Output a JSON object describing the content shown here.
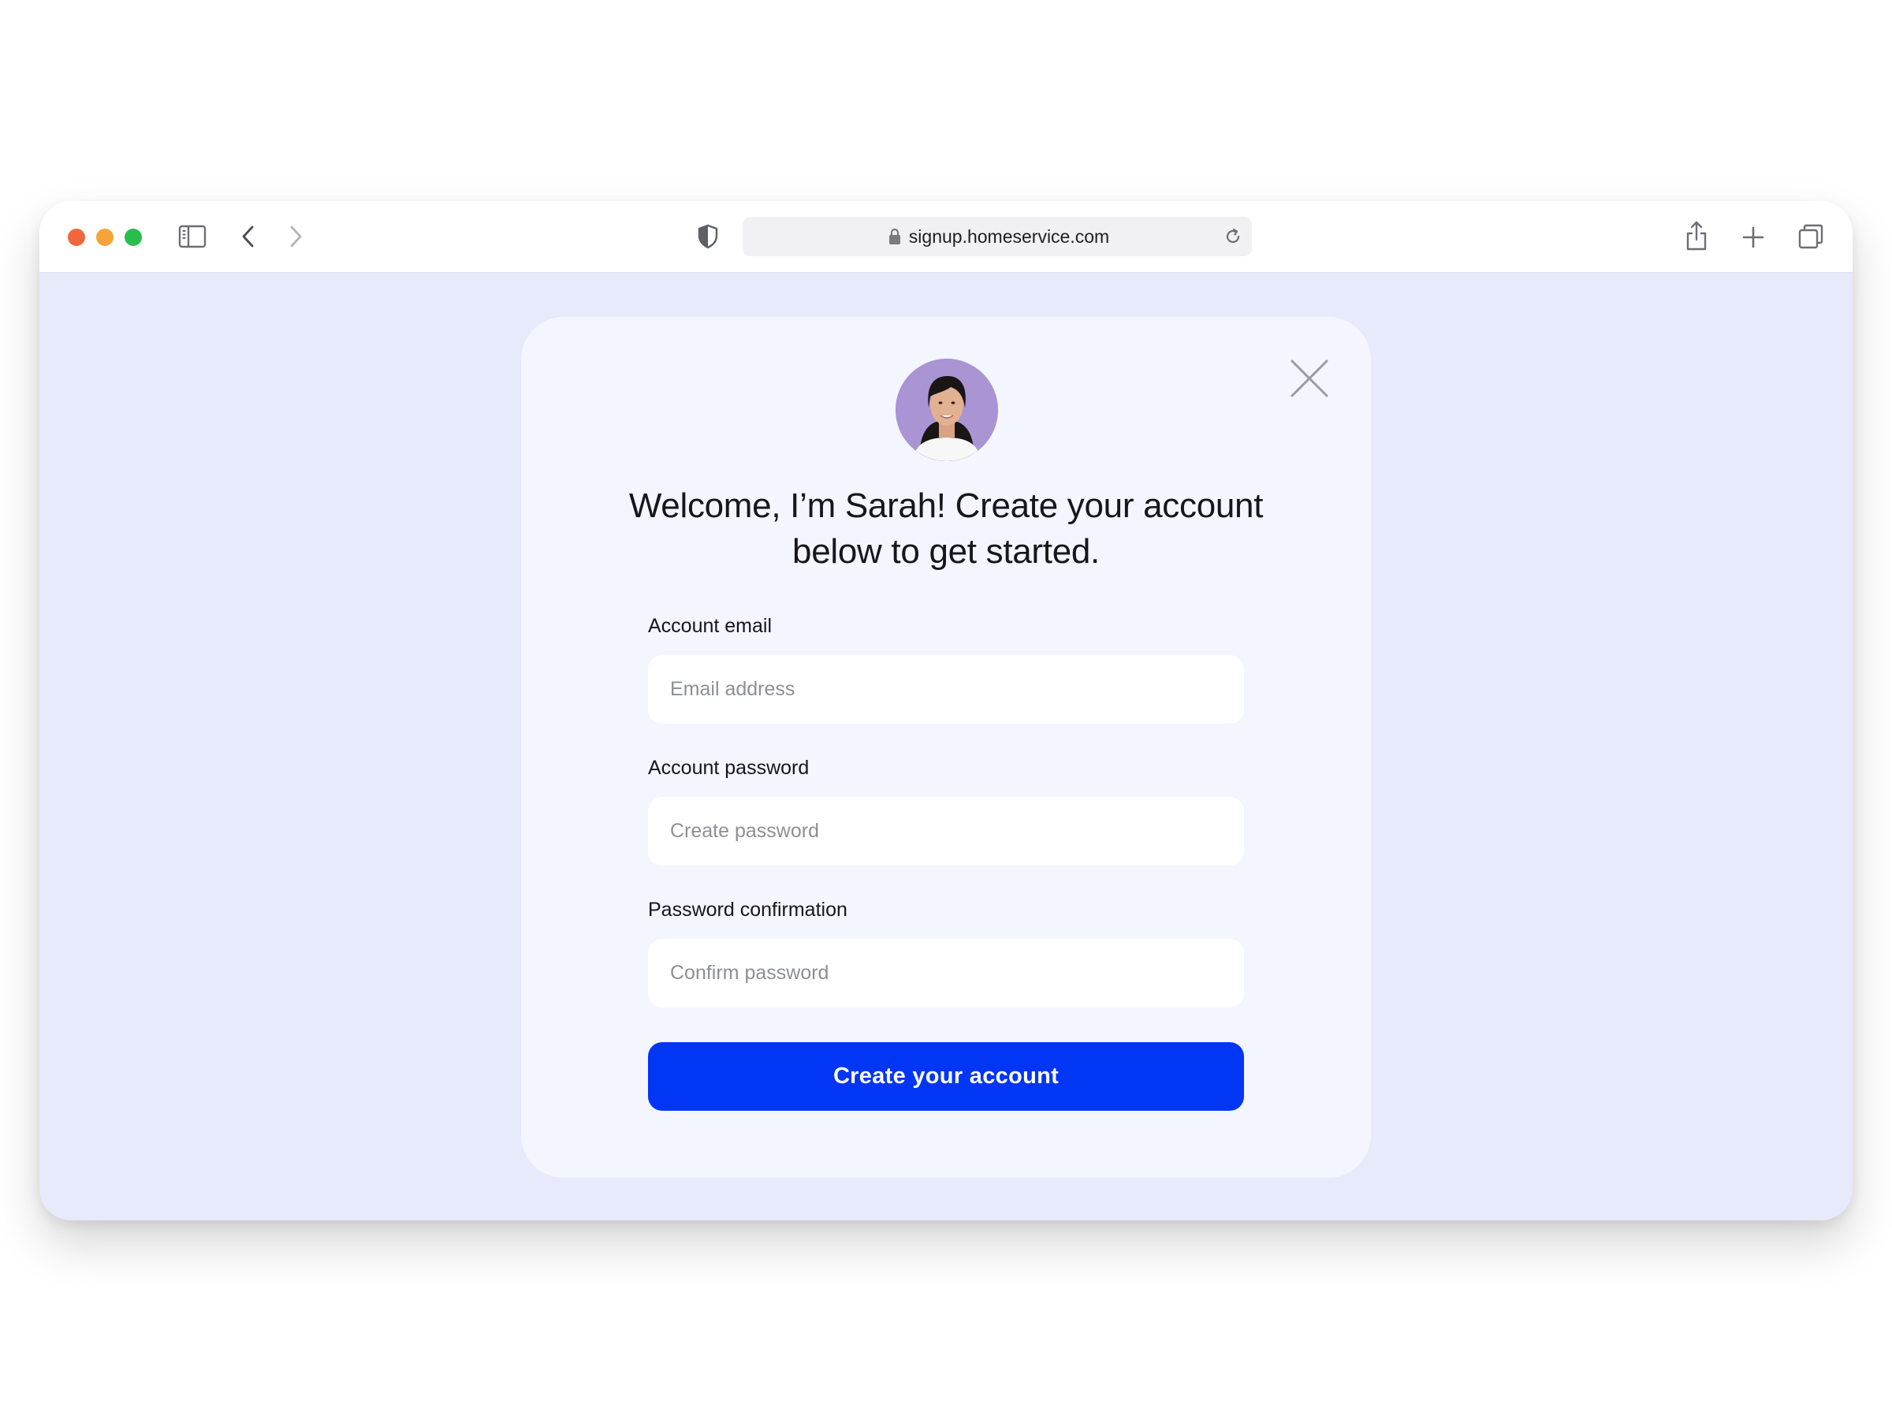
{
  "browser": {
    "url": "signup.homeservice.com",
    "traffic_lights": [
      "#f0673b",
      "#f6a33a",
      "#2bbd4c"
    ],
    "icons": [
      "sidebar-icon",
      "back-icon",
      "forward-icon",
      "shield-icon",
      "lock-icon",
      "reload-icon",
      "share-icon",
      "new-tab-icon",
      "tabs-overview-icon"
    ]
  },
  "modal": {
    "headline": "Welcome, I’m Sarah! Create your account below to get started.",
    "avatar_bg": "#a994d4",
    "fields": [
      {
        "label": "Account email",
        "placeholder": "Email address",
        "value": ""
      },
      {
        "label": "Account password",
        "placeholder": "Create password",
        "value": ""
      },
      {
        "label": "Password confirmation",
        "placeholder": "Confirm password",
        "value": ""
      }
    ],
    "submit_label": "Create your account",
    "accent": "#0236f5",
    "background": "#e6eafb"
  }
}
